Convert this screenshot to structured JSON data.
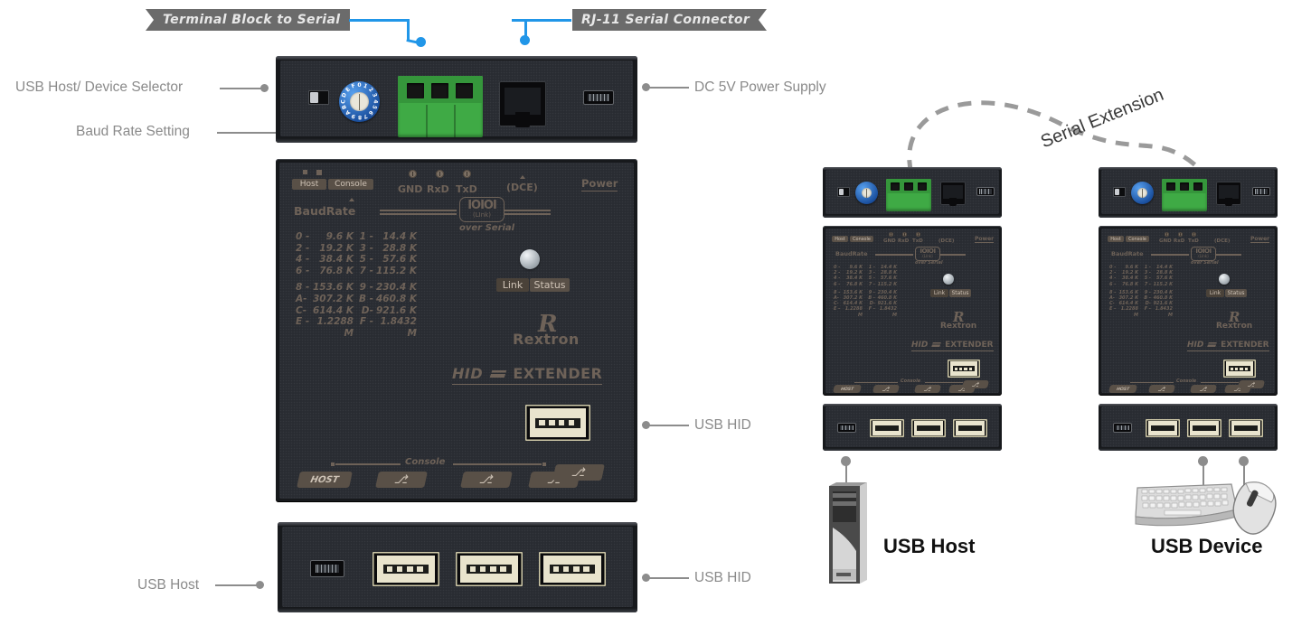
{
  "diagram": {
    "title": "USB HID Extender over Serial - connection diagram",
    "accent_blue": "#2196e8",
    "banner_gray": "#6b6b6b",
    "callout_gray": "#8a8a8a",
    "silk_color": "#6e6258",
    "terminal_green": "#3faa45",
    "rotary_blue": "#1a4f9e"
  },
  "banners": [
    {
      "id": "terminal-block",
      "label": "Terminal Block to Serial"
    },
    {
      "id": "rj11",
      "label": "RJ-11 Serial Connector"
    }
  ],
  "callouts": [
    {
      "id": "usb-host-device-selector",
      "label": "USB Host/ Device Selector"
    },
    {
      "id": "baud-rate-setting",
      "label": "Baud Rate Setting"
    },
    {
      "id": "dc-power",
      "label": "DC 5V Power Supply"
    },
    {
      "id": "usb-hid-front",
      "label": "USB HID"
    },
    {
      "id": "usb-host-rear",
      "label": "USB Host"
    },
    {
      "id": "usb-hid-rear",
      "label": "USB HID"
    }
  ],
  "serial_extension": {
    "label": "Serial Extension"
  },
  "endpoints": [
    {
      "id": "usb-host",
      "label": "USB Host"
    },
    {
      "id": "usb-device",
      "label": "USB Device"
    }
  ],
  "panel": {
    "host_label": "Host",
    "console_label": "Console",
    "leds": [
      "GND",
      "RxD",
      "TxD"
    ],
    "dce_label": "(DCE)",
    "power_label": "Power",
    "baudrate_label": "BaudRate",
    "link_glyph": "IOIOI",
    "link_sub": "(LInk)",
    "over_serial": "over Serial",
    "link_status": {
      "link": "Link",
      "status": "Status"
    },
    "brand": "Rextron",
    "brand_mark": "R",
    "product_hid": "HID",
    "product_extender": "EXTENDER",
    "console_strip_label": "Console",
    "host_port_label": "HOST",
    "usb_glyph": "⎇"
  },
  "baud_table": {
    "rows": [
      {
        "left_code": "0 -",
        "left_value": "9.6 K",
        "right_code": "1 -",
        "right_value": "14.4 K"
      },
      {
        "left_code": "2 -",
        "left_value": "19.2 K",
        "right_code": "3 -",
        "right_value": "28.8 K"
      },
      {
        "left_code": "4 -",
        "left_value": "38.4 K",
        "right_code": "5 -",
        "right_value": "57.6 K"
      },
      {
        "left_code": "6 -",
        "left_value": "76.8 K",
        "right_code": "7 -",
        "right_value": "115.2 K"
      },
      {
        "left_code": "8 -",
        "left_value": "153.6 K",
        "right_code": "9 -",
        "right_value": "230.4 K"
      },
      {
        "left_code": "A-",
        "left_value": "307.2 K",
        "right_code": "B -",
        "right_value": "460.8 K"
      },
      {
        "left_code": "C-",
        "left_value": "614.4 K",
        "right_code": "D-",
        "right_value": "921.6 K"
      },
      {
        "left_code": "E -",
        "left_value": "1.2288 M",
        "right_code": "F -",
        "right_value": "1.8432 M"
      }
    ]
  },
  "rotary_switch": {
    "digits": [
      "0",
      "1",
      "2",
      "3",
      "4",
      "5",
      "6",
      "7",
      "8",
      "9",
      "A",
      "B",
      "C",
      "D",
      "E",
      "F"
    ]
  }
}
